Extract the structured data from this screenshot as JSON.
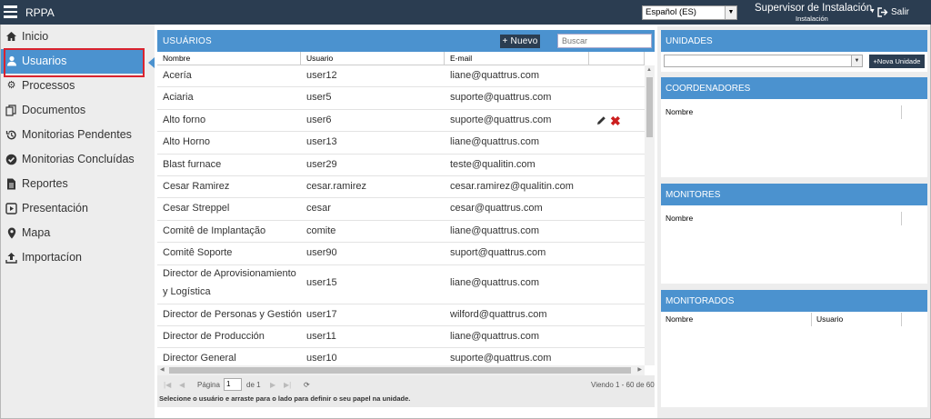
{
  "app": {
    "title": "RPPA"
  },
  "header": {
    "language": "Español (ES)",
    "user_role": "Supervisor de Instalación",
    "user_sub": "Instalación",
    "logout": "Salir"
  },
  "sidebar": {
    "items": [
      {
        "label": "Inicio",
        "icon": "home-icon"
      },
      {
        "label": "Usuarios",
        "icon": "user-icon",
        "active": true
      },
      {
        "label": "Processos",
        "icon": "gears-icon"
      },
      {
        "label": "Documentos",
        "icon": "documents-icon"
      },
      {
        "label": "Monitorias Pendentes",
        "icon": "history-icon"
      },
      {
        "label": "Monitorias Concluídas",
        "icon": "check-circle-icon"
      },
      {
        "label": "Reportes",
        "icon": "file-icon"
      },
      {
        "label": "Presentación",
        "icon": "play-square-icon"
      },
      {
        "label": "Mapa",
        "icon": "map-marker-icon"
      },
      {
        "label": "Importacíon",
        "icon": "upload-icon"
      }
    ]
  },
  "users_panel": {
    "title": "USUÁRIOS",
    "new_button": "+ Nuevo",
    "search_placeholder": "Buscar",
    "columns": [
      "Nombre",
      "Usuario",
      "E-mail"
    ],
    "rows": [
      {
        "name": "Acería",
        "user": "user12",
        "email": "liane@quattrus.com"
      },
      {
        "name": "Aciaria",
        "user": "user5",
        "email": "suporte@quattrus.com"
      },
      {
        "name": "Alto forno",
        "user": "user6",
        "email": "suporte@quattrus.com",
        "actions": true
      },
      {
        "name": "Alto Horno",
        "user": "user13",
        "email": "liane@quattrus.com"
      },
      {
        "name": "Blast furnace",
        "user": "user29",
        "email": "teste@qualitin.com"
      },
      {
        "name": "Cesar Ramirez",
        "user": "cesar.ramirez",
        "email": "cesar.ramirez@qualitin.com"
      },
      {
        "name": "Cesar Streppel",
        "user": "cesar",
        "email": "cesar@quattrus.com"
      },
      {
        "name": "Comitê de Implantação",
        "user": "comite",
        "email": "liane@quattrus.com"
      },
      {
        "name": "Comitê Soporte",
        "user": "user90",
        "email": "suport@quattrus.com"
      },
      {
        "name": "Director de Aprovisionamiento",
        "name2": "y Logística",
        "user": "user15",
        "email": "liane@quattrus.com"
      },
      {
        "name": "Director de Personas y Gestión",
        "user": "user17",
        "email": "wilford@quattrus.com"
      },
      {
        "name": "Director de Producción",
        "user": "user11",
        "email": "liane@quattrus.com"
      },
      {
        "name": "Director General",
        "user": "user10",
        "email": "suporte@quattrus.com"
      }
    ],
    "pager": {
      "page_label": "Página",
      "page_value": "1",
      "of_label": "de 1",
      "viewing": "Viendo 1 - 60 de 60"
    },
    "hint": "Selecione o usuário e arraste para o lado para definir o seu papel na unidade."
  },
  "units_panel": {
    "title": "UNIDADES",
    "new_unit_button": "+Nova Unidade"
  },
  "coordinators_panel": {
    "title": "COORDENADORES",
    "col_name": "Nombre"
  },
  "monitors_panel": {
    "title": "MONITORES",
    "col_name": "Nombre"
  },
  "monitored_panel": {
    "title": "MONITORADOS",
    "col_name": "Nombre",
    "col_user": "Usuario"
  },
  "colors": {
    "topbar": "#2b3d51",
    "accent": "#4b92cf",
    "highlight": "#d9232f",
    "delete": "#cc1f1f"
  }
}
